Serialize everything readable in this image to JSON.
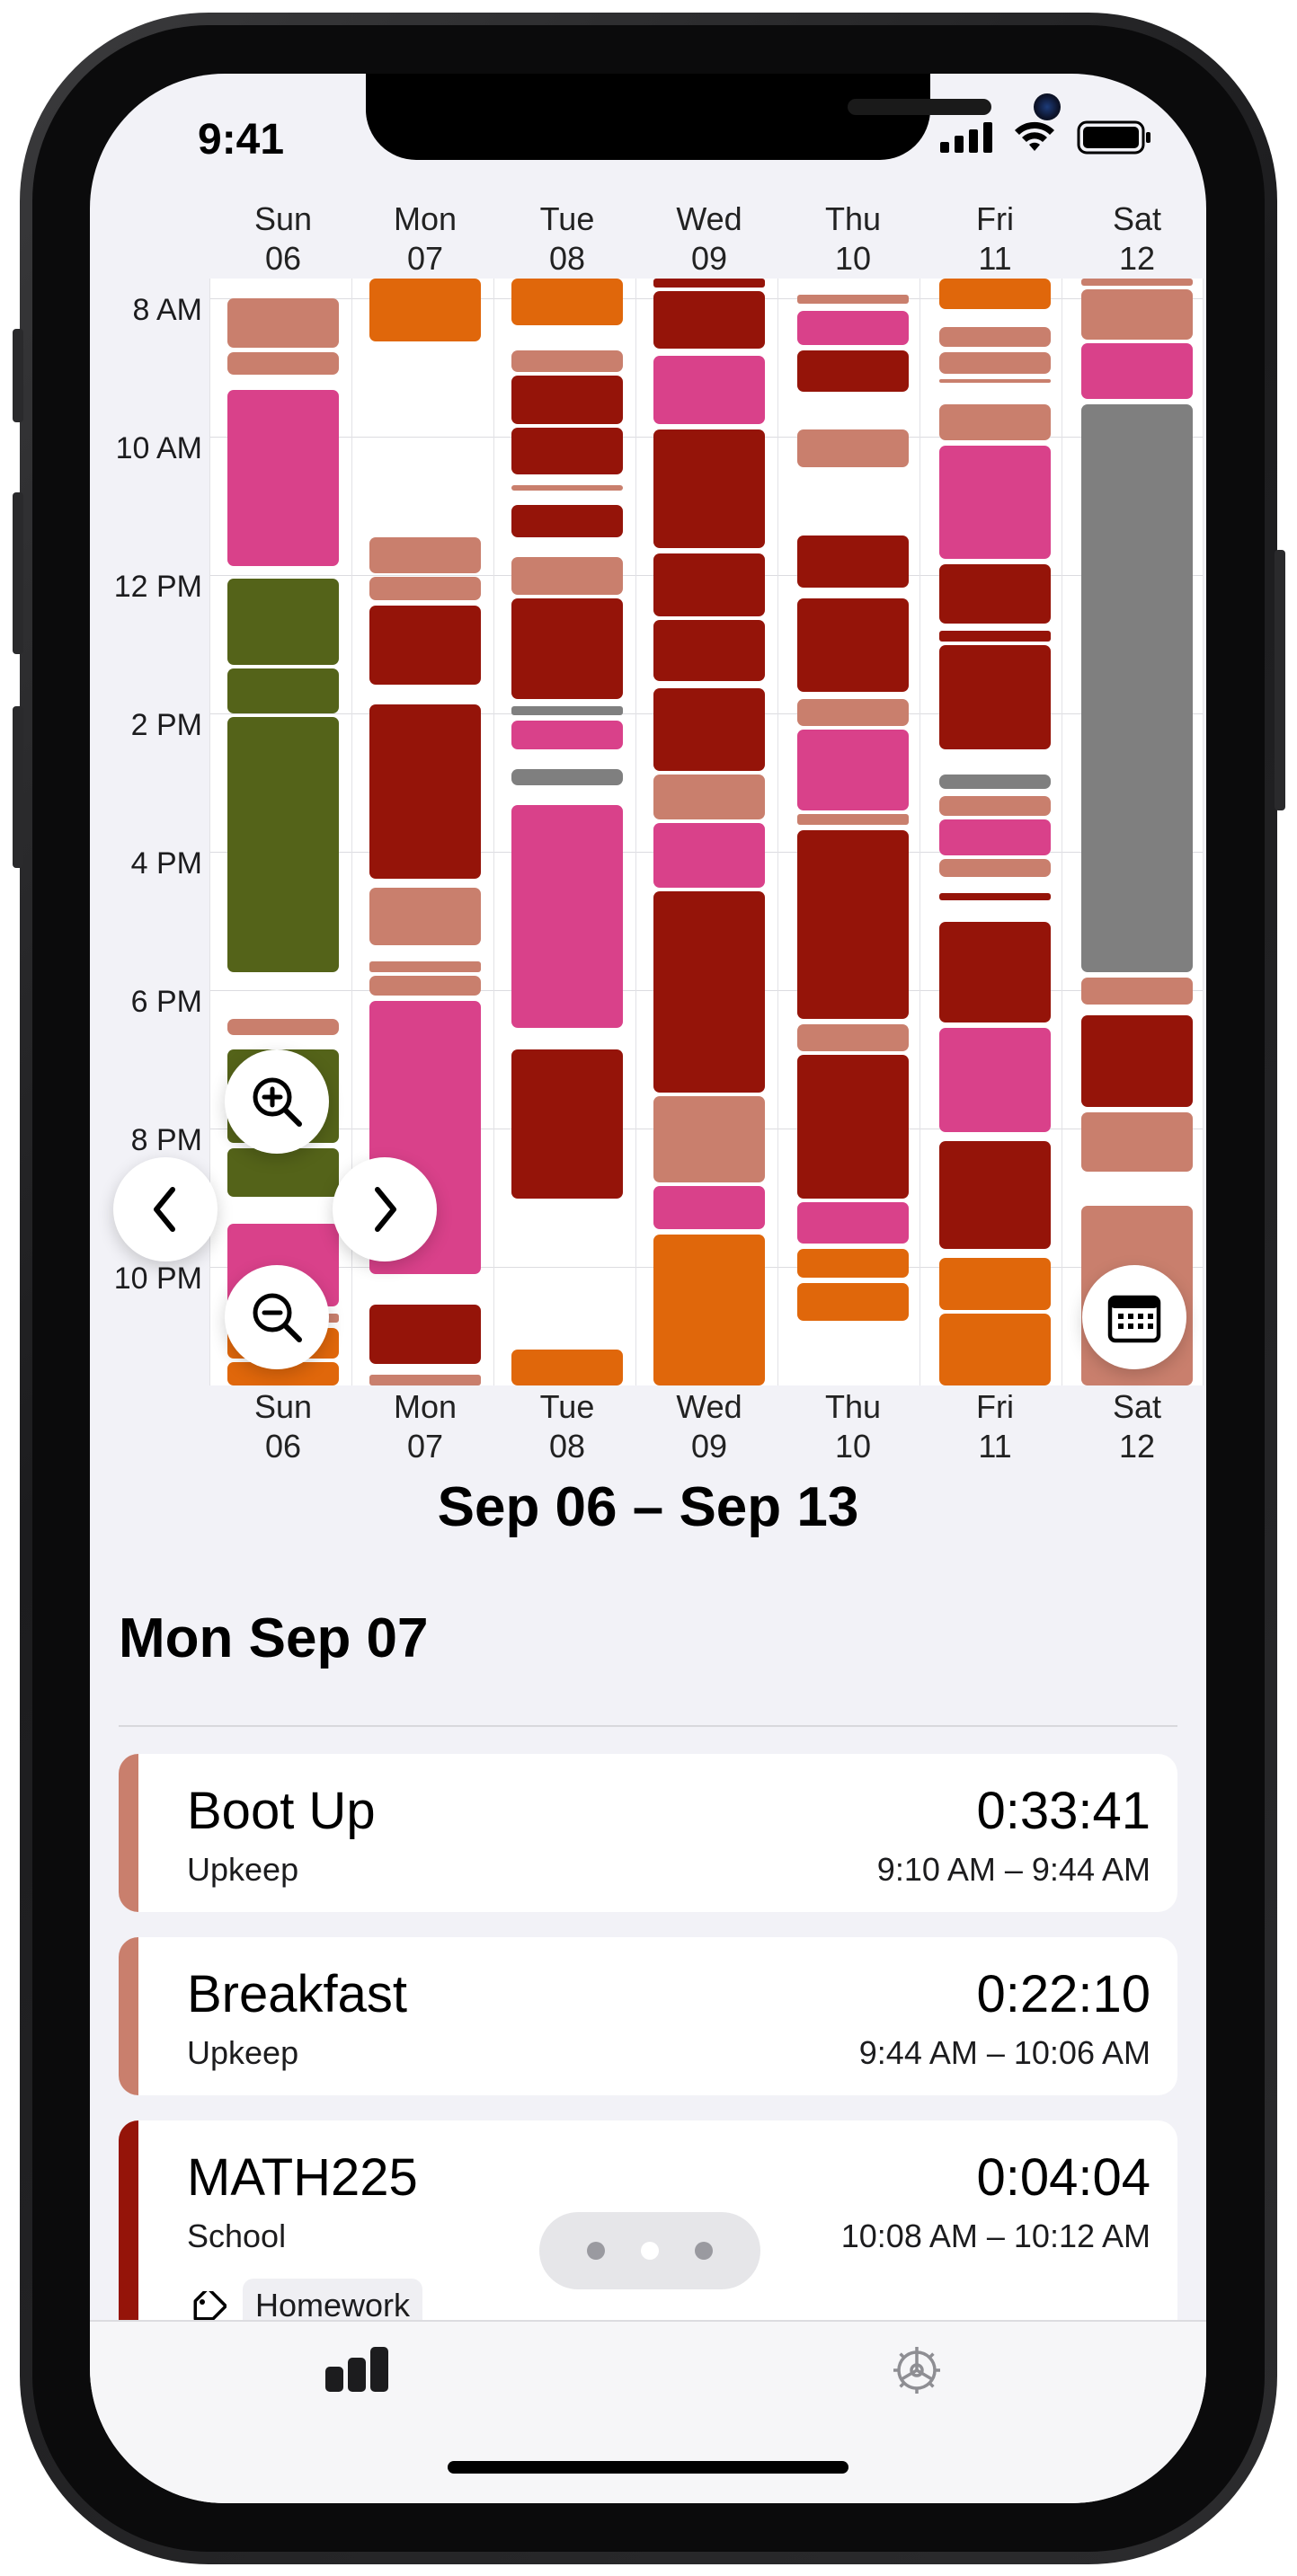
{
  "status_bar": {
    "time": "9:41"
  },
  "days": [
    {
      "dow": "Sun",
      "date": "06"
    },
    {
      "dow": "Mon",
      "date": "07"
    },
    {
      "dow": "Tue",
      "date": "08"
    },
    {
      "dow": "Wed",
      "date": "09"
    },
    {
      "dow": "Thu",
      "date": "10"
    },
    {
      "dow": "Fri",
      "date": "11"
    },
    {
      "dow": "Sat",
      "date": "12"
    }
  ],
  "hour_labels": [
    "8 AM",
    "10 AM",
    "12 PM",
    "2 PM",
    "4 PM",
    "6 PM",
    "8 PM",
    "10 PM"
  ],
  "colors": {
    "upkeep": "#c97f6d",
    "school": "#951409",
    "pink": "#d9418a",
    "green": "#546319",
    "orange": "#e0670b",
    "gray": "#7f7f7f",
    "accent": "#000000"
  },
  "week_title": "Sep 06 – Sep 13",
  "day_title": "Mon Sep 07",
  "entries": [
    {
      "name": "Boot Up",
      "category": "Upkeep",
      "duration": "0:33:41",
      "range": "9:10 AM – 9:44 AM",
      "color": "#c97f6d"
    },
    {
      "name": "Breakfast",
      "category": "Upkeep",
      "duration": "0:22:10",
      "range": "9:44 AM – 10:06 AM",
      "color": "#c97f6d"
    },
    {
      "name": "MATH225",
      "category": "School",
      "duration": "0:04:04",
      "range": "10:08 AM – 10:12 AM",
      "color": "#951409",
      "tag": "Homework"
    }
  ],
  "icons": {
    "zoom_in": "zoom-in-icon",
    "zoom_out": "zoom-out-icon",
    "prev": "chevron-left-icon",
    "next": "chevron-right-icon",
    "calendar": "calendar-icon",
    "stats_tab": "bar-chart-icon",
    "settings_tab": "gear-icon"
  }
}
